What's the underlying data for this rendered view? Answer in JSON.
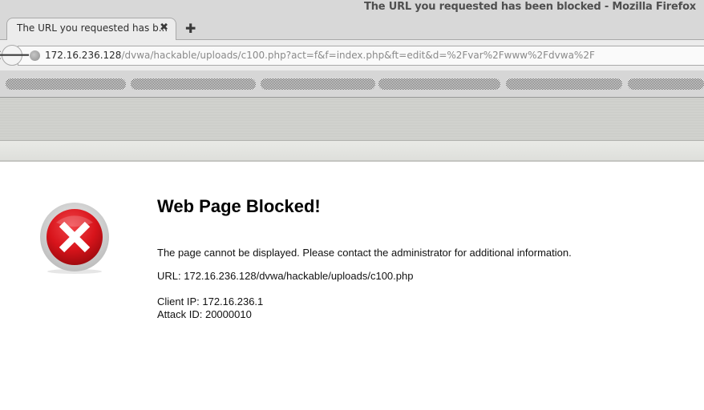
{
  "window": {
    "title": "The URL you requested has been blocked - Mozilla Firefox"
  },
  "tabs": [
    {
      "label": "The URL you requested has b...",
      "close_icon": "close-icon",
      "active": true
    }
  ],
  "new_tab_icon": "plus-icon",
  "navbar": {
    "back_icon": "back-arrow-icon",
    "site_icon": "globe-icon",
    "url_host": "172.16.236.128",
    "url_path": "/dvwa/hackable/uploads/c100.php?act=f&f=index.php&ft=edit&d=%2Fvar%2Fwww%2Fdvwa%2F"
  },
  "bookmarks": {
    "redacted": true,
    "count": 6
  },
  "page": {
    "icon": "blocked-x-icon",
    "heading": "Web Page Blocked!",
    "message": "The page cannot be displayed. Please contact the administrator for additional information.",
    "url_line": "URL: 172.16.236.128/dvwa/hackable/uploads/c100.php",
    "client_ip_line": "Client IP: 172.16.236.1",
    "attack_id_line": "Attack ID: 20000010"
  },
  "colors": {
    "icon_red": "#d8141b",
    "icon_ring": "#d9d9d9"
  }
}
